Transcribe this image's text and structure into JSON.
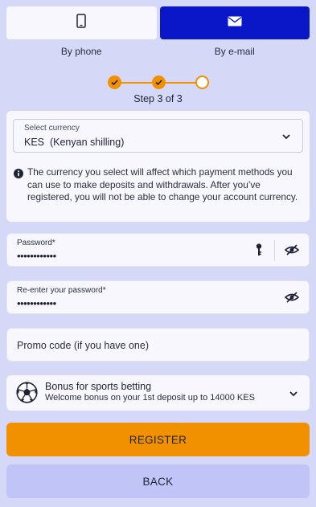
{
  "tabs": [
    {
      "label": "By phone",
      "icon": "smartphone-icon",
      "active": false
    },
    {
      "label": "By e-mail",
      "icon": "envelope-icon",
      "active": true
    }
  ],
  "stepper": {
    "text": "Step 3 of 3",
    "current": 3,
    "total": 3
  },
  "currency": {
    "label": "Select currency",
    "value": "KES  (Kenyan shilling)",
    "info": "The currency you select will affect which payment methods you can use to make deposits and withdrawals. After you’ve registered, you will not be able to change your account currency."
  },
  "password": {
    "label": "Password*",
    "value": "••••••••••••"
  },
  "password_confirm": {
    "label": "Re-enter your password*",
    "value": "••••••••••••"
  },
  "promo": {
    "placeholder": "Promo code (if you have one)"
  },
  "bonus": {
    "title": "Bonus for sports betting",
    "subtitle": "Welcome bonus on your 1st deposit up to 14000 KES",
    "icon": "soccer-ball-icon"
  },
  "buttons": {
    "register": "REGISTER",
    "back": "BACK"
  },
  "colors": {
    "accent": "#f29100",
    "primary": "#0a17c8",
    "background": "#d6d8f7",
    "back_button": "#c1c4f7"
  }
}
